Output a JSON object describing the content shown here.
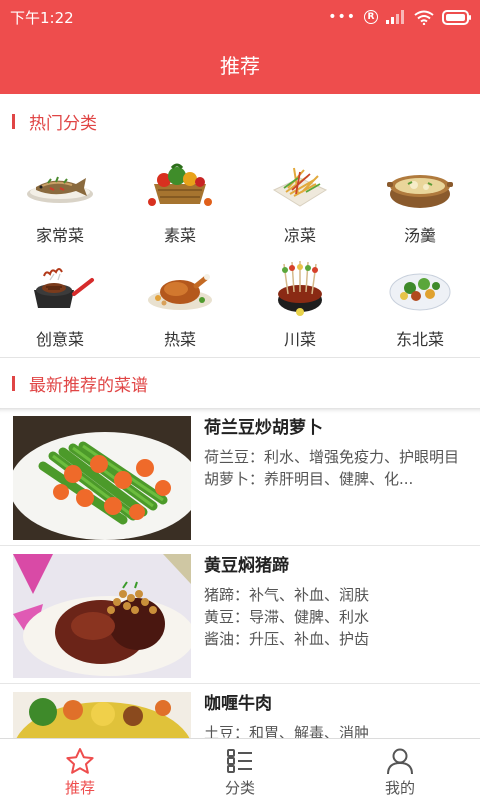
{
  "status_bar": {
    "time": "下午1:22",
    "dots": "•••"
  },
  "app_bar": {
    "title": "推荐"
  },
  "hot_categories": {
    "title": "热门分类",
    "items": [
      {
        "label": "家常菜",
        "icon": "fish-dish-icon"
      },
      {
        "label": "素菜",
        "icon": "vegetable-basket-icon"
      },
      {
        "label": "凉菜",
        "icon": "cold-salad-icon"
      },
      {
        "label": "汤羹",
        "icon": "soup-pot-icon"
      },
      {
        "label": "创意菜",
        "icon": "steak-pan-icon"
      },
      {
        "label": "热菜",
        "icon": "roast-chicken-icon"
      },
      {
        "label": "川菜",
        "icon": "skewer-pot-icon"
      },
      {
        "label": "东北菜",
        "icon": "stir-fry-plate-icon"
      }
    ]
  },
  "latest_recipes": {
    "title": "最新推荐的菜谱",
    "items": [
      {
        "title": "荷兰豆炒胡萝卜",
        "lines": [
          "荷兰豆：利水、增强免疫力、护眼明目",
          "胡萝卜：养肝明目、健脾、化..."
        ]
      },
      {
        "title": "黄豆焖猪蹄",
        "lines": [
          "猪蹄：补气、补血、润肤",
          "黄豆：导滞、健脾、利水",
          "酱油：升压、补血、护齿"
        ]
      },
      {
        "title": "咖喱牛肉",
        "lines": [
          "土豆：和胃、解毒、消肿"
        ]
      }
    ]
  },
  "tab_bar": {
    "tabs": [
      {
        "label": "推荐",
        "icon": "star-icon",
        "active": true
      },
      {
        "label": "分类",
        "icon": "list-icon",
        "active": false
      },
      {
        "label": "我的",
        "icon": "user-icon",
        "active": false
      }
    ]
  },
  "colors": {
    "accent": "#ee4d4d",
    "section_title": "#e04545"
  }
}
